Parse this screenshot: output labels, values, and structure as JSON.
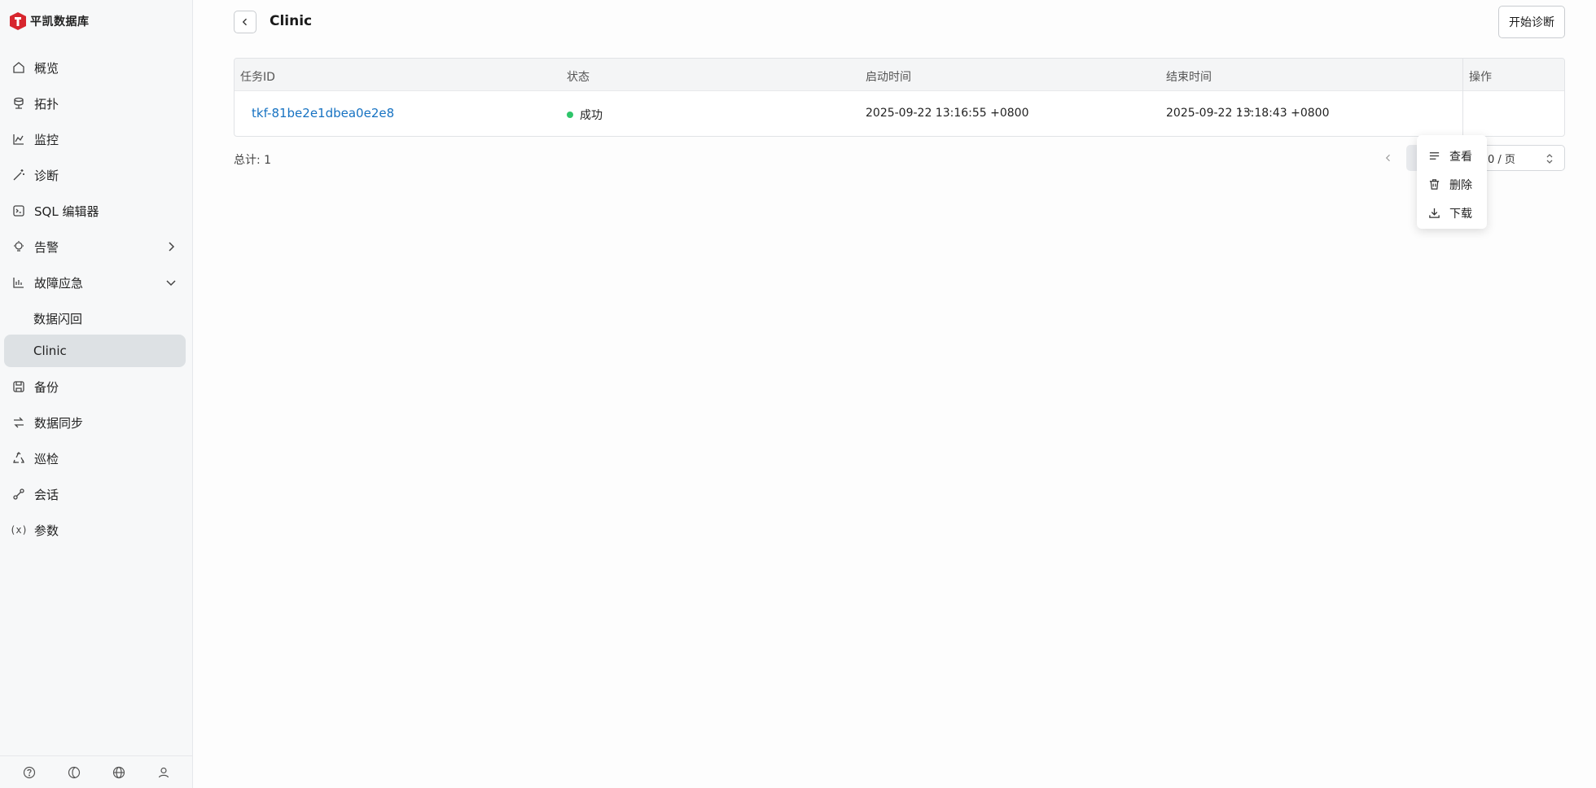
{
  "app": {
    "brand_name": "平凯数据库",
    "brand_color": "#d7262e"
  },
  "sidebar": {
    "items": [
      {
        "label": "概览",
        "icon": "home-icon"
      },
      {
        "label": "拓扑",
        "icon": "topology-icon"
      },
      {
        "label": "监控",
        "icon": "chart-icon"
      },
      {
        "label": "诊断",
        "icon": "wand-icon"
      },
      {
        "label": "SQL 编辑器",
        "icon": "sql-editor-icon"
      },
      {
        "label": "告警",
        "icon": "bulb-icon",
        "expand": "collapsed"
      },
      {
        "label": "故障应急",
        "icon": "emergency-icon",
        "expand": "expanded"
      },
      {
        "label": "数据闪回",
        "sub": true
      },
      {
        "label": "Clinic",
        "sub": true,
        "active": true
      },
      {
        "label": "备份",
        "icon": "save-icon"
      },
      {
        "label": "数据同步",
        "icon": "sync-icon"
      },
      {
        "label": "巡检",
        "icon": "recycle-icon"
      },
      {
        "label": "会话",
        "icon": "session-icon"
      },
      {
        "label": "参数",
        "icon": "variable-icon"
      }
    ],
    "bottom_icons": [
      "help-icon",
      "theme-icon",
      "globe-icon",
      "user-icon"
    ]
  },
  "header": {
    "title": "Clinic",
    "start_button": "开始诊断"
  },
  "table": {
    "columns": [
      "任务ID",
      "状态",
      "启动时间",
      "结束时间",
      "操作"
    ],
    "rows": [
      {
        "task_id": "tkf-81be2e1dbea0e2e8",
        "status": "成功",
        "status_color": "#2ec56a",
        "start_time": "2025-09-22 13:16:55 +0800",
        "end_time": "2025-09-22 13:18:43 +0800",
        "actions": "···"
      }
    ]
  },
  "footer": {
    "total": "总计: 1",
    "page_size": "0 / 页"
  },
  "dropdown": {
    "items": [
      {
        "label": "查看",
        "icon": "lines-icon"
      },
      {
        "label": "删除",
        "icon": "trash-icon"
      },
      {
        "label": "下载",
        "icon": "download-icon"
      }
    ]
  }
}
